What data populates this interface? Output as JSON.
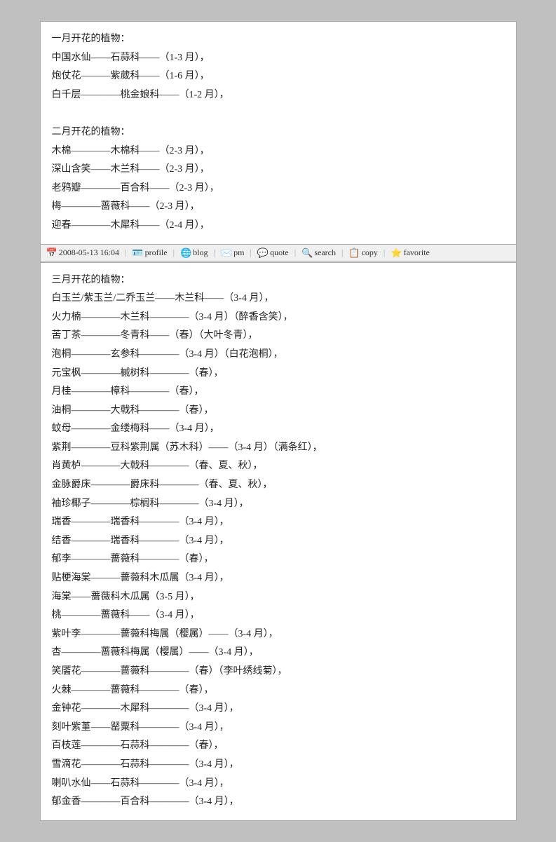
{
  "section1": {
    "lines": [
      "一月开花的植物：",
      "中国水仙——石蒜科——（1-3 月），",
      "炮仗花———紫葳科——（1-6 月），",
      "白千层————桃金娘科——（1-2 月），",
      "",
      "二月开花的植物：",
      "木棉————木棉科——（2-3 月），",
      "深山含笑——木兰科——（2-3 月），",
      "老鸦瓣————百合科——（2-3 月），",
      "梅————蔷薇科——（2-3 月），",
      "迎春————木犀科——（2-4 月），"
    ]
  },
  "toolbar": {
    "date": "2008-05-13 16:04",
    "items": [
      {
        "icon": "📋",
        "label": "profile"
      },
      {
        "icon": "📝",
        "label": "blog"
      },
      {
        "icon": "👤",
        "label": "pm"
      },
      {
        "icon": "💬",
        "label": "quote"
      },
      {
        "icon": "🔍",
        "label": "search"
      },
      {
        "icon": "📄",
        "label": "copy"
      },
      {
        "icon": "⭐",
        "label": "favorite"
      }
    ]
  },
  "section2": {
    "lines": [
      "三月开花的植物：",
      "白玉兰/紫玉兰/二乔玉兰——木兰科——（3-4 月），",
      "火力楠————木兰科————（3-4 月）（醉香含笑），",
      "苦丁茶————冬青科——（春）（大叶冬青），",
      "泡桐————玄参科————（3-4 月）（白花泡桐），",
      "元宝枫————槭树科————（春），",
      "月桂————樟科————（春），",
      "油桐————大戟科————（春），",
      "蚊母————金缕梅科——（3-4 月），",
      "紫荆————豆科紫荆属（苏木科）——（3-4 月）（满条红），",
      "肖黄栌————大戟科————（春、夏、秋），",
      "金脉爵床————爵床科————（春、夏、秋），",
      "袖珍椰子————棕榈科————（3-4 月），",
      "瑞香————瑞香科————（3-4 月），",
      "结香————瑞香科————（3-4 月），",
      "郁李————蔷薇科————（春），",
      "贴梗海棠———蔷薇科木瓜属（3-4 月），",
      "海棠——蔷薇科木瓜属（3-5 月），",
      "桃————蔷薇科——（3-4 月），",
      "紫叶李————蔷薇科梅属（樱属）——（3-4 月），",
      "杏————蔷薇科梅属（樱属）——（3-4 月），",
      "笑靥花————蔷薇科————（春）（李叶绣线菊），",
      "火棘————蔷薇科————（春），",
      "金钟花————木犀科————（3-4 月），",
      "刻叶紫堇——罂粟科————（3-4 月），",
      "百枝莲————石蒜科————（春），",
      "雪滴花————石蒜科————（3-4 月），",
      "喇叭水仙——石蒜科————（3-4 月），",
      "郁金香————百合科————（3-4 月），"
    ]
  }
}
